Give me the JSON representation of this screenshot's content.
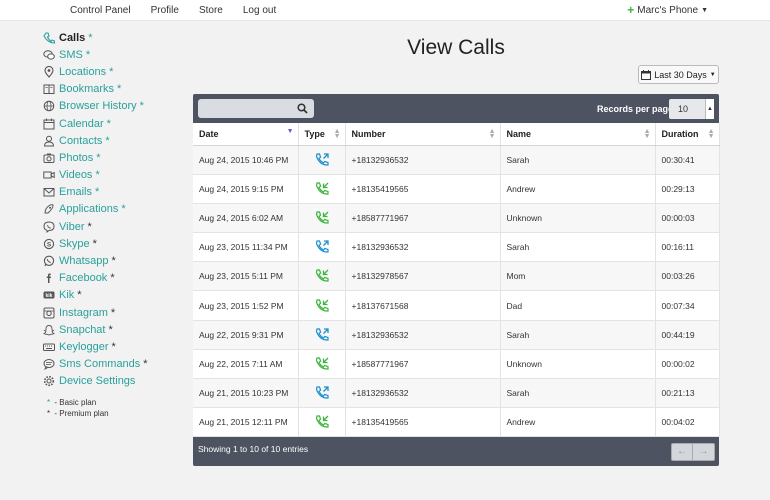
{
  "topnav": [
    "Control Panel",
    "Profile",
    "Store",
    "Log out"
  ],
  "device_menu": "Marc's Phone",
  "sidebar": {
    "items": [
      {
        "label": "Calls",
        "icon": "phone-icon",
        "star": "basic",
        "active": true
      },
      {
        "label": "SMS",
        "icon": "chat-icon",
        "star": "basic"
      },
      {
        "label": "Locations",
        "icon": "location-pin-icon",
        "star": "basic"
      },
      {
        "label": "Bookmarks",
        "icon": "book-icon",
        "star": "basic"
      },
      {
        "label": "Browser History",
        "icon": "globe-icon",
        "star": "basic"
      },
      {
        "label": "Calendar",
        "icon": "calendar-icon",
        "star": "basic"
      },
      {
        "label": "Contacts",
        "icon": "person-icon",
        "star": "basic"
      },
      {
        "label": "Photos",
        "icon": "camera-icon",
        "star": "basic"
      },
      {
        "label": "Videos",
        "icon": "video-icon",
        "star": "basic"
      },
      {
        "label": "Emails",
        "icon": "envelope-icon",
        "star": "basic"
      },
      {
        "label": "Applications",
        "icon": "rocket-icon",
        "star": "basic"
      },
      {
        "label": "Viber",
        "icon": "viber-icon",
        "star": "premium"
      },
      {
        "label": "Skype",
        "icon": "skype-icon",
        "star": "premium"
      },
      {
        "label": "Whatsapp",
        "icon": "whatsapp-icon",
        "star": "premium"
      },
      {
        "label": "Facebook",
        "icon": "facebook-icon",
        "star": "premium"
      },
      {
        "label": "Kik",
        "icon": "kik-icon",
        "star": "premium"
      },
      {
        "label": "Instagram",
        "icon": "instagram-icon",
        "star": "premium"
      },
      {
        "label": "Snapchat",
        "icon": "snapchat-icon",
        "star": "premium"
      },
      {
        "label": "Keylogger",
        "icon": "keyboard-icon",
        "star": "premium"
      },
      {
        "label": "Sms Commands",
        "icon": "chat-command-icon",
        "star": "premium"
      },
      {
        "label": "Device Settings",
        "icon": "gear-icon",
        "star": ""
      }
    ],
    "star": "*",
    "legend": {
      "basic": "- Basic plan",
      "premium": "- Premium plan"
    }
  },
  "page_title": "View Calls",
  "date_filter": "Last 30 Days",
  "table": {
    "records_per_page_label": "Records per page:",
    "records_per_page": "10",
    "columns": [
      "Date",
      "Type",
      "Number",
      "Name",
      "Duration"
    ],
    "rows": [
      {
        "date": "Aug 24, 2015 10:46 PM",
        "type": "outgoing",
        "number": "+18132936532",
        "name": "Sarah",
        "duration": "00:30:41"
      },
      {
        "date": "Aug 24, 2015 9:15 PM",
        "type": "incoming",
        "number": "+18135419565",
        "name": "Andrew",
        "duration": "00:29:13"
      },
      {
        "date": "Aug 24, 2015 6:02 AM",
        "type": "incoming",
        "number": "+18587771967",
        "name": "Unknown",
        "duration": "00:00:03"
      },
      {
        "date": "Aug 23, 2015 11:34 PM",
        "type": "outgoing",
        "number": "+18132936532",
        "name": "Sarah",
        "duration": "00:16:11"
      },
      {
        "date": "Aug 23, 2015 5:11 PM",
        "type": "incoming",
        "number": "+18132978567",
        "name": "Mom",
        "duration": "00:03:26"
      },
      {
        "date": "Aug 23, 2015 1:52 PM",
        "type": "incoming",
        "number": "+18137671568",
        "name": "Dad",
        "duration": "00:07:34"
      },
      {
        "date": "Aug 22, 2015 9:31 PM",
        "type": "outgoing",
        "number": "+18132936532",
        "name": "Sarah",
        "duration": "00:44:19"
      },
      {
        "date": "Aug 22, 2015 7:11 AM",
        "type": "incoming",
        "number": "+18587771967",
        "name": "Unknown",
        "duration": "00:00:02"
      },
      {
        "date": "Aug 21, 2015 10:23 PM",
        "type": "outgoing",
        "number": "+18132936532",
        "name": "Sarah",
        "duration": "00:21:13"
      },
      {
        "date": "Aug 21, 2015 12:11 PM",
        "type": "incoming",
        "number": "+18135419565",
        "name": "Andrew",
        "duration": "00:04:02"
      }
    ],
    "info": "Showing 1 to 10 of 10 entries"
  },
  "colors": {
    "accent": "#2aa09a",
    "outgoing": "#1a8fd1",
    "incoming": "#3db53d",
    "panel": "#4d5360"
  }
}
